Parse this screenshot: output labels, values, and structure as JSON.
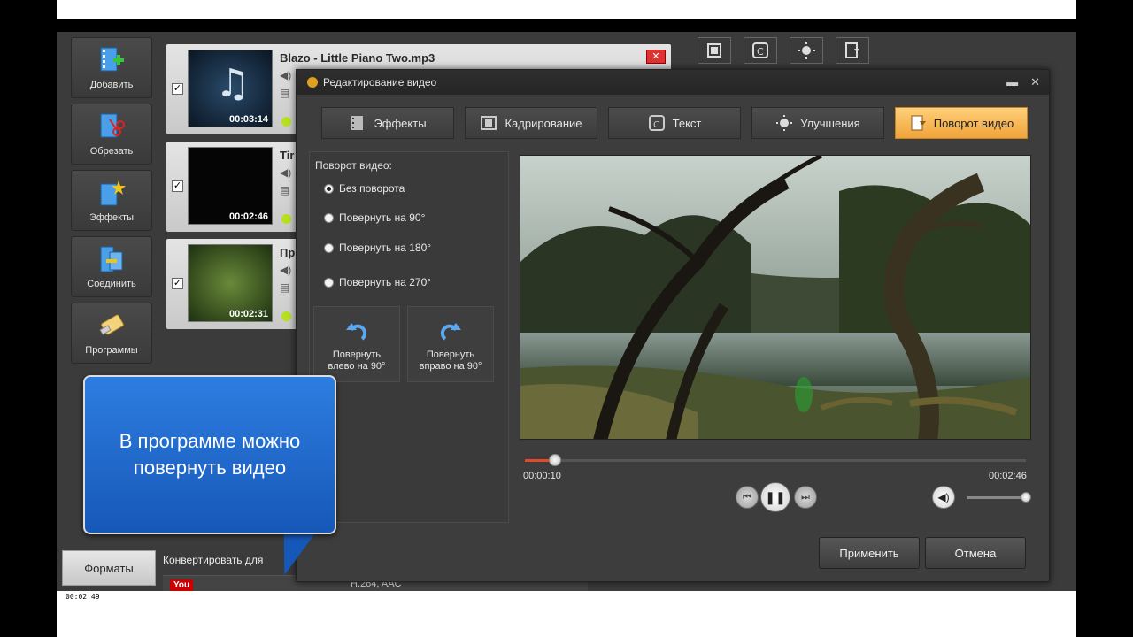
{
  "sidebar": {
    "items": [
      {
        "label": "Добавить",
        "icon": "add-film-icon"
      },
      {
        "label": "Обрезать",
        "icon": "cut-film-icon"
      },
      {
        "label": "Эффекты",
        "icon": "effects-film-icon"
      },
      {
        "label": "Соединить",
        "icon": "join-film-icon"
      },
      {
        "label": "Программы",
        "icon": "tools-icon"
      }
    ]
  },
  "files": [
    {
      "name": "Blazo - Little Piano Two.mp3",
      "duration": "00:03:14",
      "checked": "✓",
      "thumb": "music-note"
    },
    {
      "name": "Tir",
      "duration": "00:02:46",
      "checked": "✓",
      "thumb": "black"
    },
    {
      "name": "Пр",
      "duration": "00:02:31",
      "checked": "✓",
      "thumb": "forest"
    }
  ],
  "dialog": {
    "title": "Редактирование видео",
    "minimize": "▬",
    "close": "✕",
    "tabs": [
      {
        "label": "Эффекты",
        "icon": "effects-icon",
        "active": false
      },
      {
        "label": "Кадрирование",
        "icon": "crop-icon",
        "active": false
      },
      {
        "label": "Текст",
        "icon": "text-icon",
        "active": false
      },
      {
        "label": "Улучшения",
        "icon": "brightness-icon",
        "active": false
      },
      {
        "label": "Поворот видео",
        "icon": "rotate-video-icon",
        "active": true
      }
    ],
    "rotation_title": "Поворот видео:",
    "options": [
      {
        "label": "Без поворота",
        "checked": true
      },
      {
        "label": "Повернуть на 90°",
        "checked": false
      },
      {
        "label": "Повернуть на 180°",
        "checked": false
      },
      {
        "label": "Повернуть на 270°",
        "checked": false
      }
    ],
    "rotate_left_label": "Повернуть\nвлево  на 90°",
    "rotate_right_label": "Повернуть\nвправо на 90°",
    "current_time": "00:00:10",
    "total_time": "00:02:46",
    "progress_fraction": 0.06,
    "volume_fraction": 1.0,
    "apply_label": "Применить",
    "cancel_label": "Отмена"
  },
  "bottom": {
    "formats_label": "Форматы",
    "convert_label": "Конвертировать для",
    "youtube_logo": "You",
    "codec": "H.264, AAC",
    "tiny_timestamp": "00:02:49"
  },
  "callout": {
    "text": "В программе можно повернуть видео"
  },
  "colors": {
    "accent_tab": "#f0a43a",
    "callout_blue": "#1658b8",
    "seek_fill": "#e04a2a",
    "progress_blue": "#1a6ec0"
  }
}
